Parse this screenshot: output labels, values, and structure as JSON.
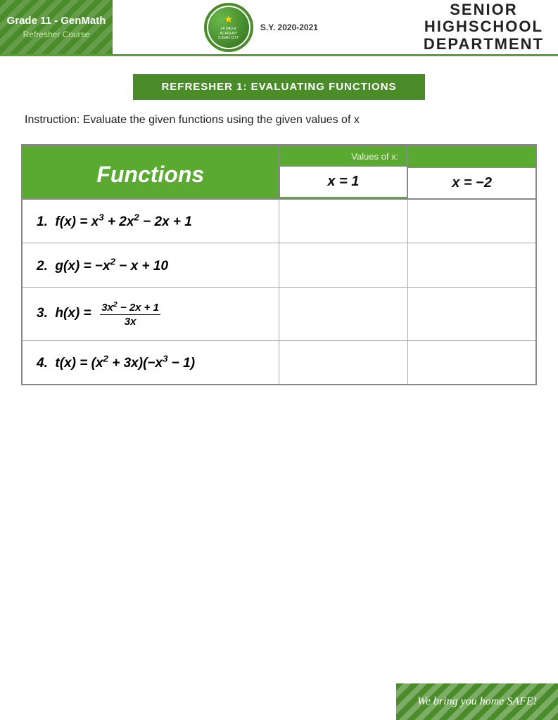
{
  "header": {
    "grade": "Grade 11 - GenMath",
    "subtitle": "Refresher Course",
    "logo_text": "LA SALLE ACADEMY",
    "logo_location": "ILIGAN CITY",
    "sy": "S.Y. 2020-2021",
    "school_line1": "SENIOR",
    "school_line2": "HIGHSCHOOL",
    "school_line3": "DEPARTMENT"
  },
  "banner": "REFRESHER 1: EVALUATING FUNCTIONS",
  "instruction": "Instruction: Evaluate the given functions using the given values of x",
  "table": {
    "col1_header": "Functions",
    "values_label": "Values of x:",
    "x1_label": "x = 1",
    "x2_label": "x = −2",
    "rows": [
      {
        "num": "1.",
        "func_html": "f(x) = x³ + 2x² − 2x + 1"
      },
      {
        "num": "2.",
        "func_html": "g(x) = −x² − x + 10"
      },
      {
        "num": "3.",
        "func_html": "h(x) = (3x²−2x+1) / 3x"
      },
      {
        "num": "4.",
        "func_html": "t(x) = (x² + 3x)(−x³ − 1)"
      }
    ]
  },
  "footer": {
    "text": "We bring you home SAFE!"
  }
}
